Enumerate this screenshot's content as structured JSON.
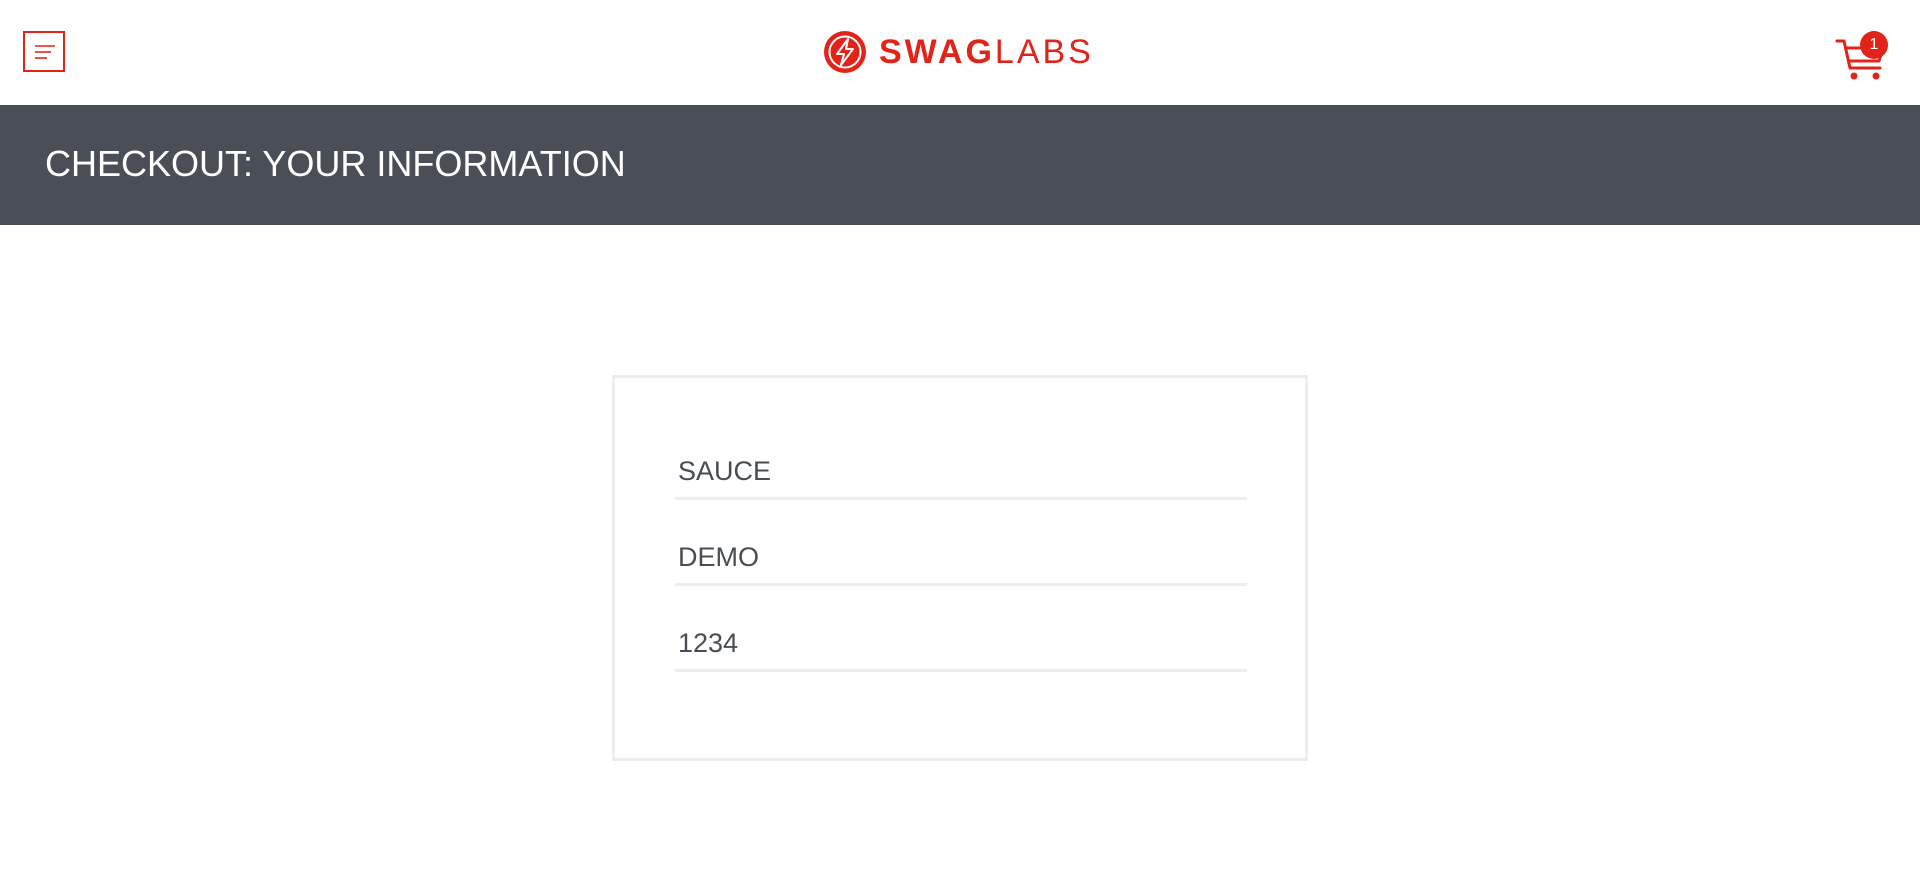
{
  "header": {
    "logo": {
      "bold": "SWAG",
      "light": "LABS"
    },
    "cart": {
      "badge_count": "1"
    }
  },
  "title_bar": {
    "title": "CHECKOUT: YOUR INFORMATION"
  },
  "form": {
    "first_name": {
      "value": "SAUCE"
    },
    "last_name": {
      "value": "DEMO"
    },
    "postal_code": {
      "value": "1234"
    }
  },
  "colors": {
    "brand": "#e2231a",
    "title_bar_bg": "#4a4e56",
    "field_text": "#484c55",
    "border": "#ededed"
  },
  "icons": {
    "menu": "menu-icon",
    "logo_mark": "lightning-bolt-icon",
    "cart": "shopping-cart-icon"
  }
}
